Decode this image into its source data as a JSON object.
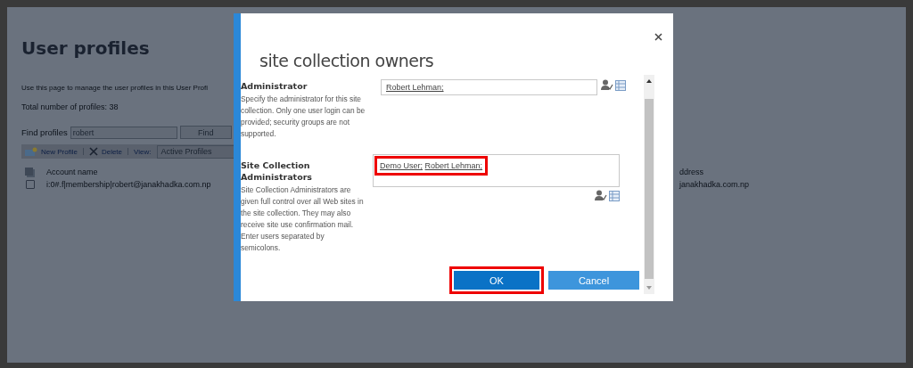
{
  "page": {
    "title": "User profiles",
    "description": "Use this page to manage the user profiles in this User Profi",
    "total": "Total number of profiles: 38",
    "find": {
      "label": "Find profiles",
      "value": "robert",
      "button": "Find"
    },
    "toolbar": {
      "new_profile": "New Profile",
      "delete": "Delete",
      "view_label": "View:",
      "view_value": "Active Profiles"
    },
    "table": {
      "columns": [
        "Account name",
        "ddress"
      ],
      "rows": [
        {
          "checked": false,
          "cells": [
            "i:0#.f|membership|robert@janakhadka.com.np",
            "janakhadka.com.np"
          ]
        }
      ]
    }
  },
  "dialog": {
    "title": "site collection owners",
    "sections": [
      {
        "heading": "Administrator",
        "description": "Specify the administrator for this site collection. Only one user login can be provided; security groups are not supported.",
        "names": [
          "Robert Lehman;"
        ],
        "kind": "single",
        "highlighted": false
      },
      {
        "heading": "Site Collection Administrators",
        "description": "Site Collection Administrators are given full control over all Web sites in the site collection. They may also receive site use confirmation mail. Enter users separated by semicolons.",
        "names": [
          "Demo User;",
          "Robert Lehman;"
        ],
        "kind": "multi",
        "highlighted": true
      }
    ],
    "buttons": [
      {
        "label": "OK",
        "kind": "primary",
        "highlighted": true
      },
      {
        "label": "Cancel",
        "kind": "secondary",
        "highlighted": false
      }
    ]
  }
}
